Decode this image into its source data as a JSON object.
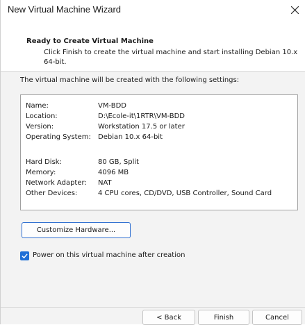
{
  "window": {
    "title": "New Virtual Machine Wizard"
  },
  "header": {
    "title": "Ready to Create Virtual Machine",
    "description": "Click Finish to create the virtual machine and start installing Debian 10.x 64-bit."
  },
  "intro_text": "The virtual machine will be created with the following settings:",
  "settings": [
    {
      "label": "Name:",
      "value": "VM-BDD"
    },
    {
      "label": "Location:",
      "value": "D:\\Ecole-it\\1RTR\\VM-BDD"
    },
    {
      "label": "Version:",
      "value": "Workstation 17.5 or later"
    },
    {
      "label": "Operating System:",
      "value": "Debian 10.x 64-bit"
    },
    {
      "label": "Hard Disk:",
      "value": "80 GB, Split"
    },
    {
      "label": "Memory:",
      "value": "4096 MB"
    },
    {
      "label": "Network Adapter:",
      "value": "NAT"
    },
    {
      "label": "Other Devices:",
      "value": "4 CPU cores, CD/DVD, USB Controller, Sound Card"
    }
  ],
  "customize_button": "Customize Hardware...",
  "power_on_checkbox": {
    "label": "Power on this virtual machine after creation",
    "checked": true
  },
  "footer": {
    "back": "< Back",
    "finish": "Finish",
    "cancel": "Cancel"
  },
  "colors": {
    "accent": "#1f6fd6",
    "window_bg": "#f3f3f3",
    "header_bg": "#ffffff"
  },
  "icons": {
    "close": "close-icon",
    "check": "checkmark-icon"
  }
}
